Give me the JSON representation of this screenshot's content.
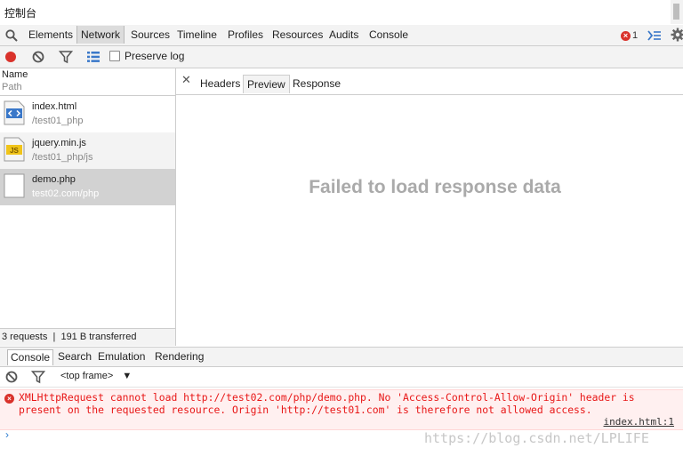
{
  "window": {
    "title": "控制台"
  },
  "tabs": [
    {
      "label": "Elements"
    },
    {
      "label": "Network"
    },
    {
      "label": "Sources"
    },
    {
      "label": "Timeline"
    },
    {
      "label": "Profiles"
    },
    {
      "label": "Resources"
    },
    {
      "label": "Audits"
    },
    {
      "label": "Console"
    }
  ],
  "selected_tab": "Network",
  "error_count": "1",
  "toolbar": {
    "preserve_log_label": "Preserve log",
    "preserve_log_checked": false
  },
  "request_list": {
    "header_name": "Name",
    "header_path": "Path",
    "items": [
      {
        "name": "index.html",
        "path": "/test01_php",
        "icon": "html-file-icon"
      },
      {
        "name": "jquery.min.js",
        "path": "/test01_php/js",
        "icon": "js-file-icon"
      },
      {
        "name": "demo.php",
        "path": "test02.com/php",
        "icon": "blank-file-icon"
      }
    ],
    "selected": "demo.php",
    "status_text": "3 requests  |  191 B transferred"
  },
  "detail": {
    "tabs": [
      {
        "label": "Headers"
      },
      {
        "label": "Preview"
      },
      {
        "label": "Response"
      }
    ],
    "selected_tab": "Preview",
    "message": "Failed to load response data"
  },
  "drawer": {
    "tabs": [
      {
        "label": "Console"
      },
      {
        "label": "Search"
      },
      {
        "label": "Emulation"
      },
      {
        "label": "Rendering"
      }
    ],
    "selected_tab": "Console",
    "frame_selector": "<top frame>",
    "frame_arrow": "▼",
    "error_message": "XMLHttpRequest cannot load http://test02.com/php/demo.php. No 'Access-Control-Allow-Origin' header is present on the requested resource. Origin 'http://test01.com' is therefore not allowed access.",
    "error_source": "index.html:1",
    "prompt_symbol": "›"
  },
  "watermark": "https://blog.csdn.net/LPLIFE",
  "colors": {
    "error": "#d9322b",
    "error_text": "#e81717",
    "accent": "#2c7bd0",
    "record": "#d9322b"
  }
}
